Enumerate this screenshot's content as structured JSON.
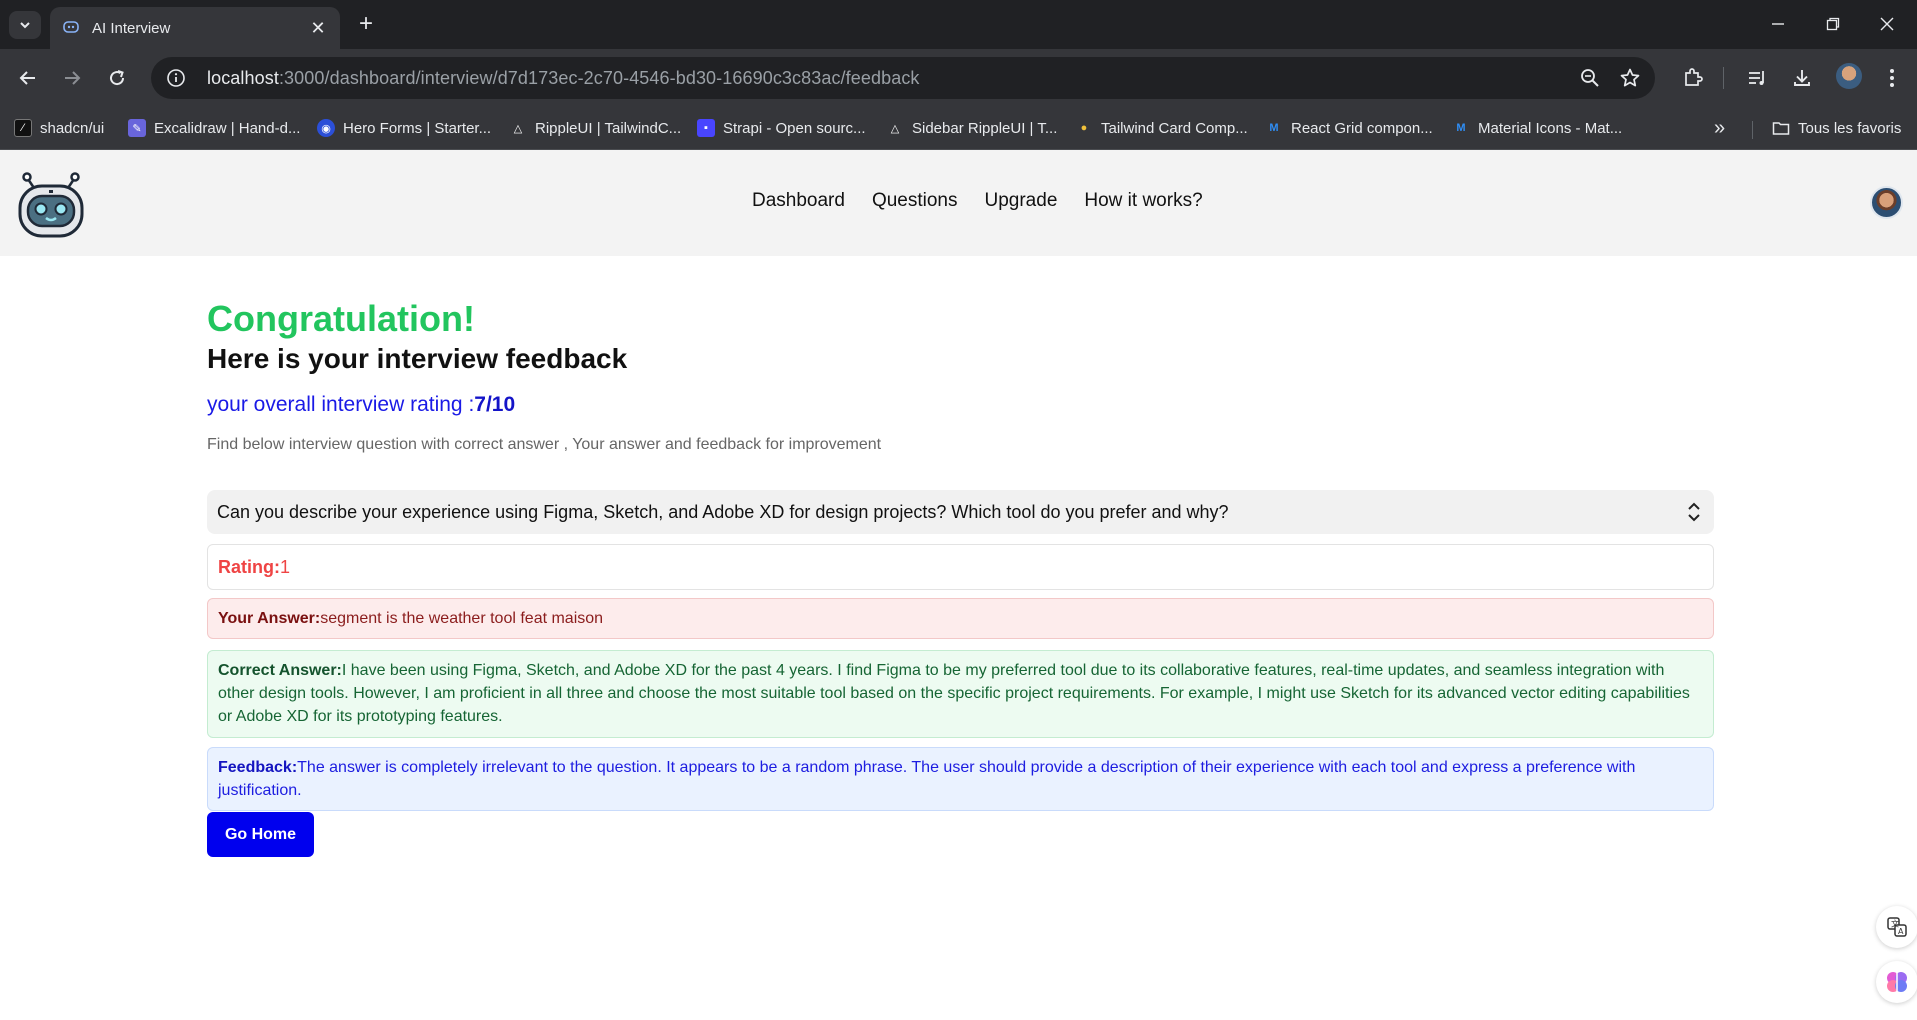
{
  "browser": {
    "tab_title": "AI Interview",
    "url_host": "localhost",
    "url_rest": ":3000/dashboard/interview/d7d173ec-2c70-4546-bd30-16690c3c83ac/feedback",
    "bookmarks": [
      {
        "label": "shadcn/ui",
        "icon": "shadcn-icon",
        "color": "#111111"
      },
      {
        "label": "Excalidraw | Hand-d...",
        "icon": "excalidraw-icon",
        "color": "#6965db"
      },
      {
        "label": "Hero Forms | Starter...",
        "icon": "hero-forms-icon",
        "color": "#3b6cf6"
      },
      {
        "label": "RippleUI | TailwindC...",
        "icon": "rippleui-icon",
        "color": "#ffffff"
      },
      {
        "label": "Strapi - Open sourc...",
        "icon": "strapi-icon",
        "color": "#4945ff"
      },
      {
        "label": "Sidebar RippleUI | T...",
        "icon": "rippleui-icon",
        "color": "#ffffff"
      },
      {
        "label": "Tailwind Card Comp...",
        "icon": "tailwind-card-icon",
        "color": "#f0c13a"
      },
      {
        "label": "React Grid compon...",
        "icon": "mui-icon",
        "color": "#2f8ef6"
      },
      {
        "label": "Material Icons - Mat...",
        "icon": "mui-icon",
        "color": "#2f8ef6"
      }
    ],
    "all_bookmarks_label": "Tous les favoris"
  },
  "header": {
    "logo_icon": "robot-logo-icon",
    "nav": [
      "Dashboard",
      "Questions",
      "Upgrade",
      "How it works?"
    ]
  },
  "feedback": {
    "congrats": "Congratulation!",
    "subtitle": "Here is your interview feedback",
    "overall_label": "your overall interview rating :",
    "overall_value": "7/10",
    "instructions": "Find below interview question with correct answer , Your answer and feedback for improvement",
    "question": "Can you describe your experience using Figma, Sketch, and Adobe XD for design projects? Which tool do you prefer and why?",
    "rating_label": "Rating:",
    "rating_value": "1",
    "your_answer_label": "Your Answer:",
    "your_answer": "segment is the weather tool feat maison",
    "correct_answer_label": "Correct Answer:",
    "correct_answer": "I have been using Figma, Sketch, and Adobe XD for the past 4 years. I find Figma to be my preferred tool due to its collaborative features, real-time updates, and seamless integration with other design tools. However, I am proficient in all three and choose the most suitable tool based on the specific project requirements. For example, I might use Sketch for its advanced vector editing capabilities or Adobe XD for its prototyping features.",
    "feedback_label": "Feedback:",
    "feedback": "The answer is completely irrelevant to the question. It appears to be a random phrase. The user should provide a description of their experience with each tool and express a preference with justification.",
    "go_home": "Go Home"
  },
  "colors": {
    "congrats": "#22c55e",
    "primary": "#0000ee",
    "rating": "#ef4444"
  }
}
